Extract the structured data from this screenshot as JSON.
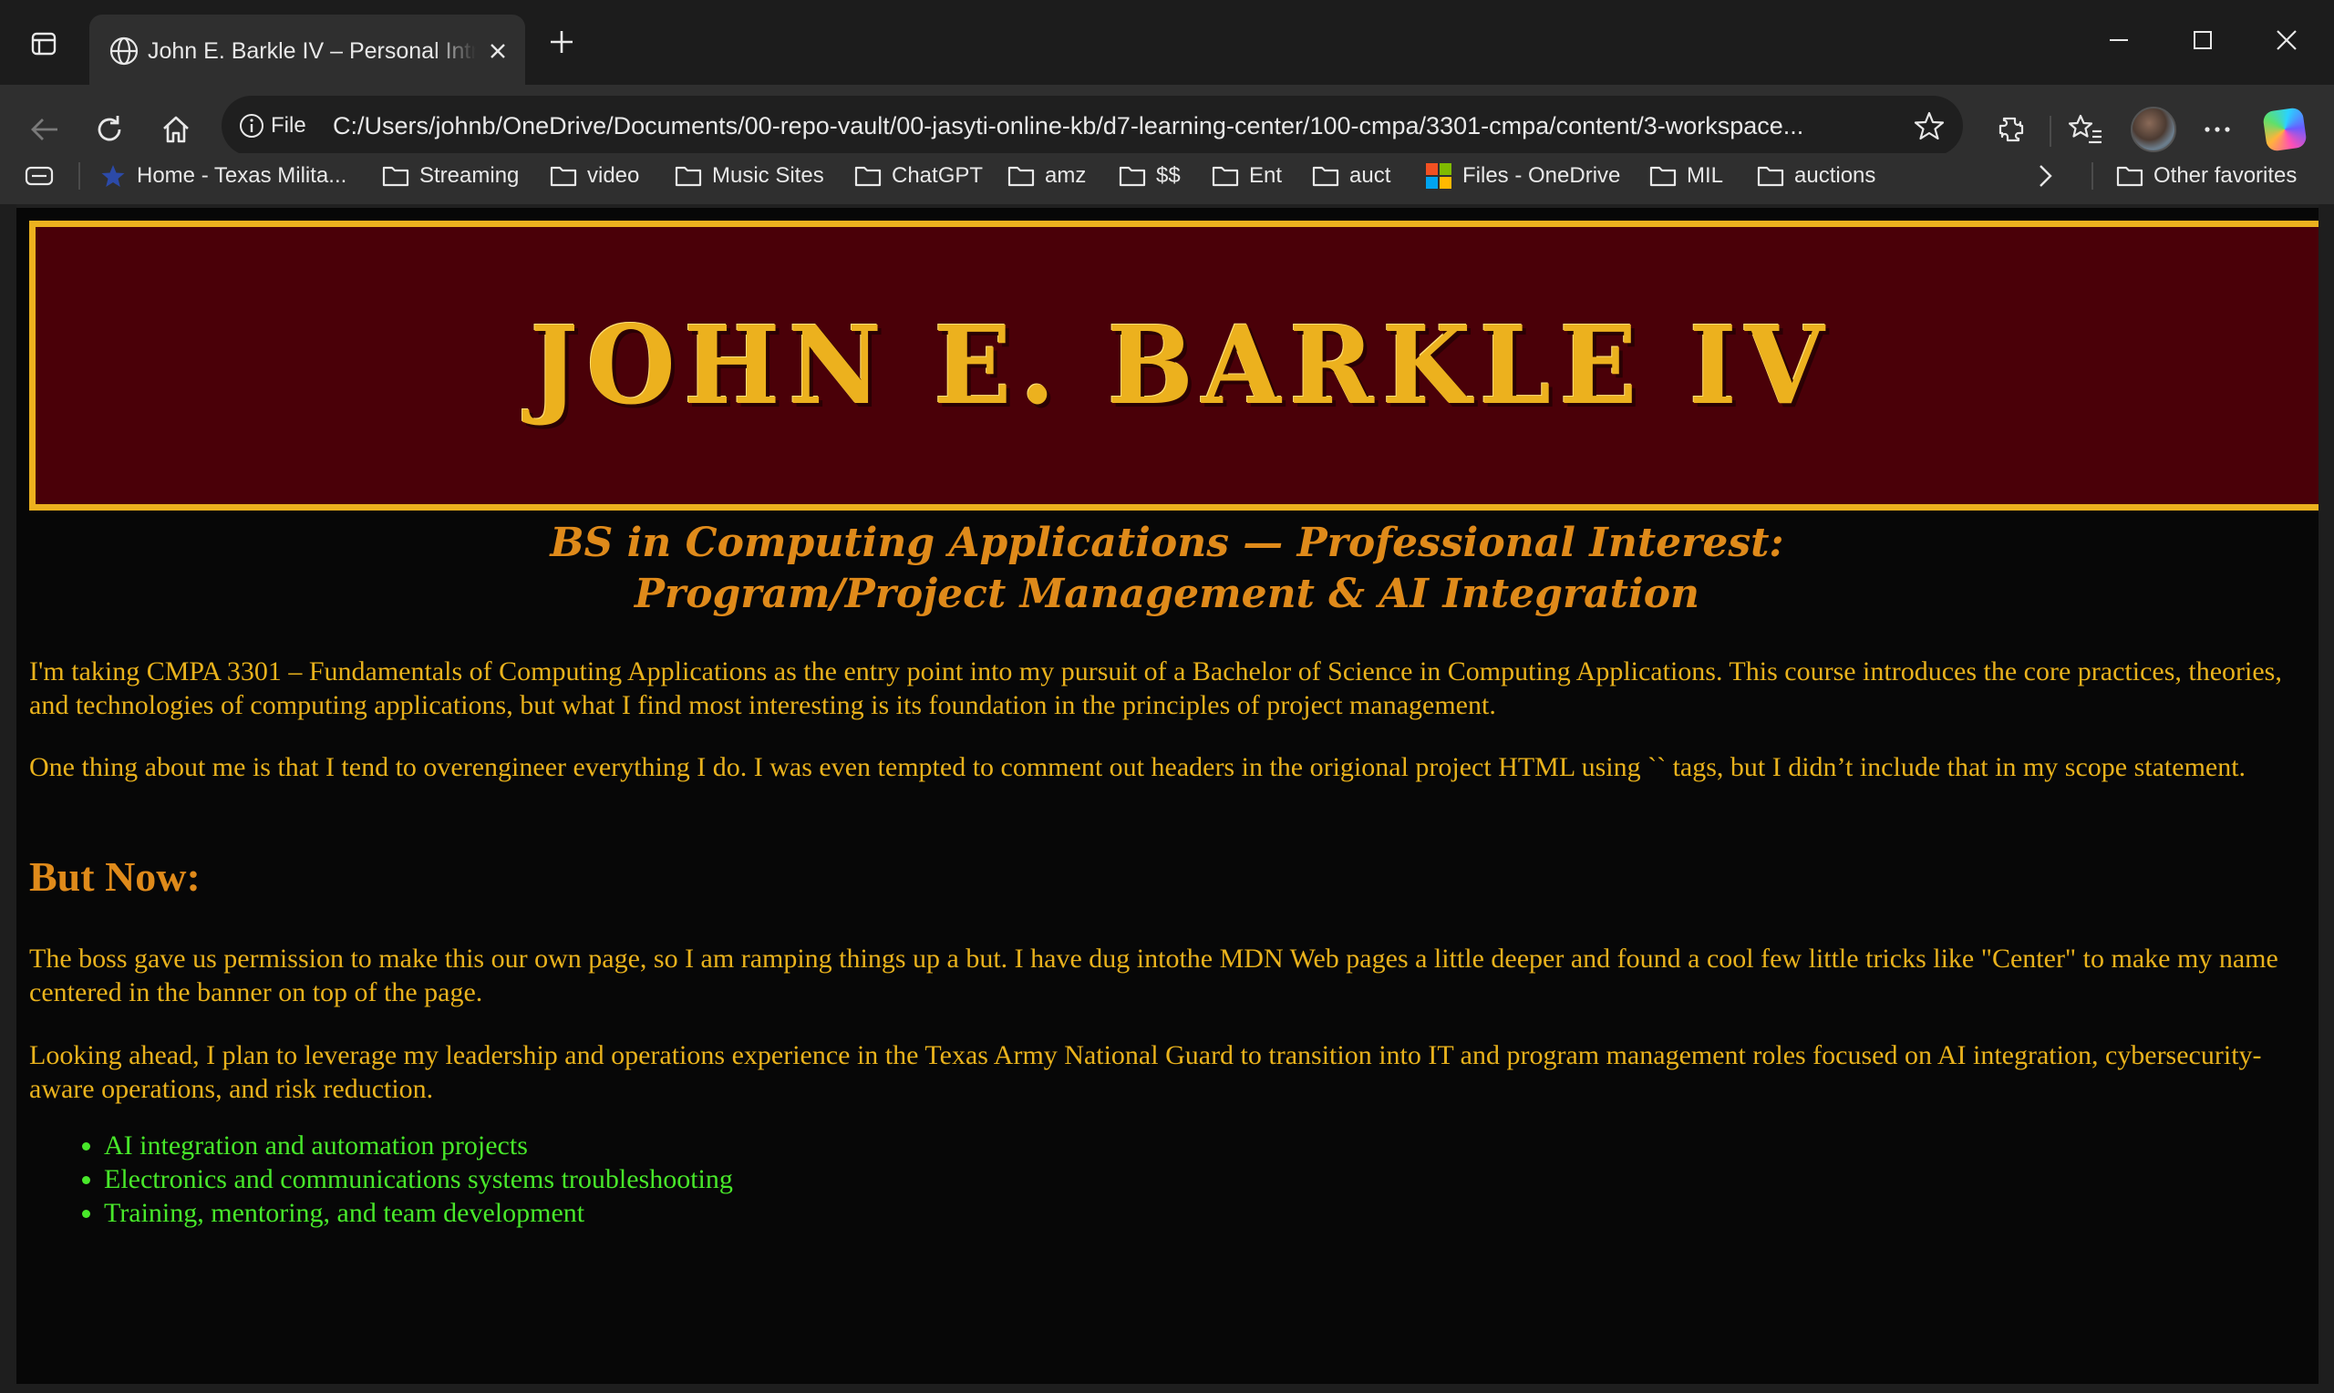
{
  "browser": {
    "tab_title": "John E. Barkle IV – Personal Introduction",
    "address_prefix": "File",
    "url": "C:/Users/johnb/OneDrive/Documents/00-repo-vault/00-jasyti-online-kb/d7-learning-center/100-cmpa/3301-cmpa/content/3-workspace..."
  },
  "bookmarks": {
    "items": [
      {
        "label": "Home - Texas Milita...",
        "icon": "star-icon"
      },
      {
        "label": "Streaming",
        "icon": "folder-icon"
      },
      {
        "label": "video",
        "icon": "folder-icon"
      },
      {
        "label": "Music Sites",
        "icon": "folder-icon"
      },
      {
        "label": "ChatGPT",
        "icon": "folder-icon"
      },
      {
        "label": "amz",
        "icon": "folder-icon"
      },
      {
        "label": "$$",
        "icon": "folder-icon"
      },
      {
        "label": "Ent",
        "icon": "folder-icon"
      },
      {
        "label": "auct",
        "icon": "folder-icon"
      },
      {
        "label": "Files - OneDrive",
        "icon": "microsoft-logo-icon"
      },
      {
        "label": "MIL",
        "icon": "folder-icon"
      },
      {
        "label": "auctions",
        "icon": "folder-icon"
      }
    ],
    "other": "Other favorites"
  },
  "page": {
    "banner_name": "John E. Barkle IV",
    "subtitle_line1": "BS in Computing Applications — Professional Interest:",
    "subtitle_line2": "Program/Project Management & AI Integration",
    "para1": "I'm taking CMPA 3301 – Fundamentals of Computing Applications as the entry point into my pursuit of a Bachelor of Science in Computing Applications. This course introduces the core practices, theories, and technologies of computing applications, but what I find most interesting is its foundation in the principles of project management.",
    "para2": "One thing about me is that I tend to overengineer everything I do. I was even tempted to comment out headers in the origional project HTML using `` tags, but I didn’t include that in my scope statement.",
    "heading": "But Now:",
    "para3": "The boss gave us permission to make this our own page, so I am ramping things up a but. I have dug intothe MDN Web pages a little deeper and found a cool few little tricks like \"Center\" to make my name centered in the banner on top of the page.",
    "para4": "Looking ahead, I plan to leverage my leadership and operations experience in the Texas Army National Guard to transition into IT and program management roles focused on AI integration, cybersecurity-aware operations, and risk reduction.",
    "list": [
      "AI integration and automation projects",
      "Electronics and communications systems troubleshooting",
      "Training, mentoring, and team development"
    ]
  },
  "colors": {
    "banner_bg": "#4a0008",
    "gold": "#ecb11e",
    "orange": "#df8a1a",
    "green": "#48e82a",
    "page_bg": "#070707"
  }
}
